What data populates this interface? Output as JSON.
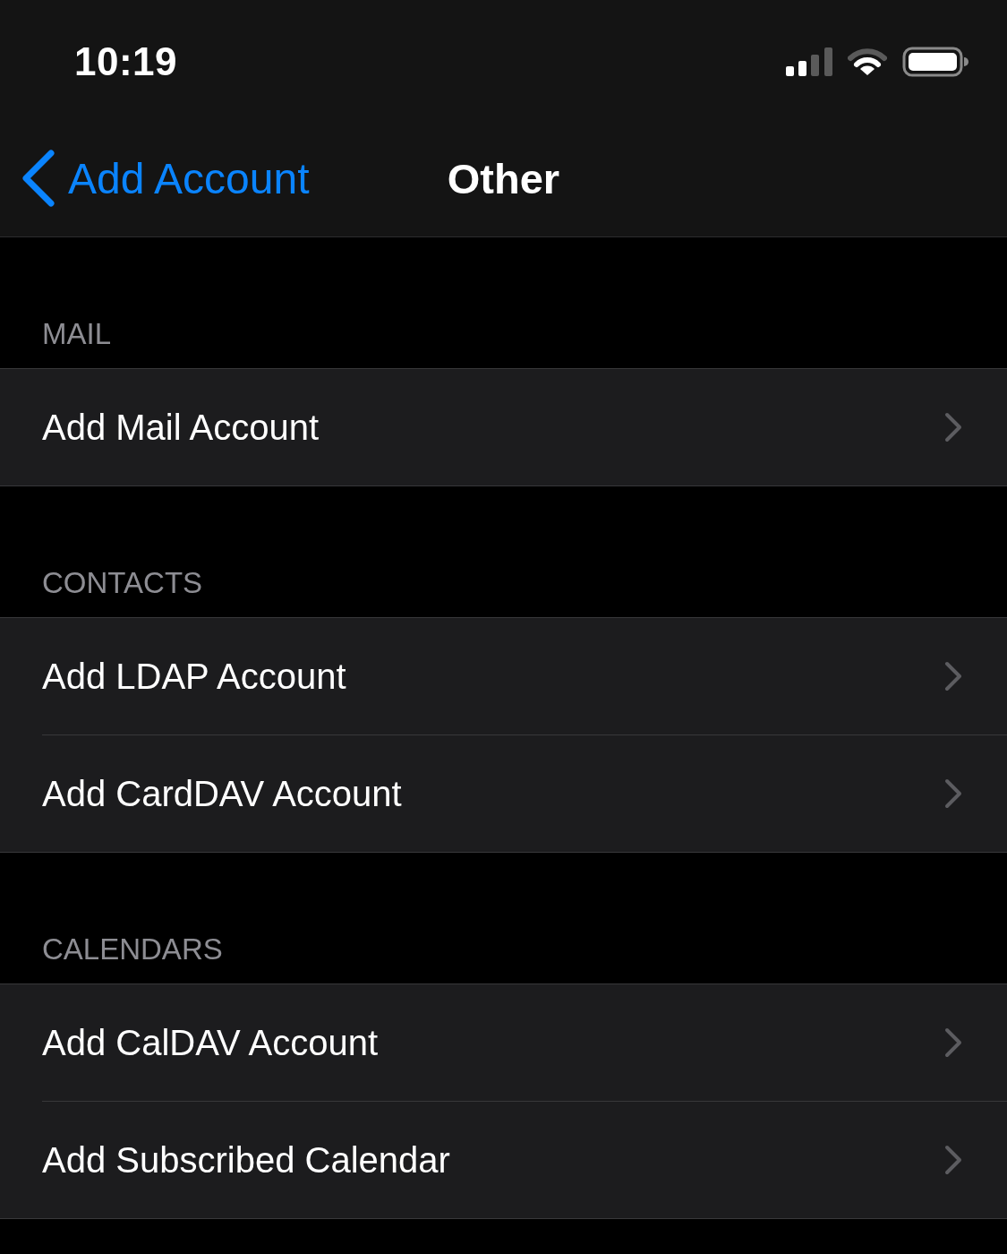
{
  "status_bar": {
    "time": "10:19"
  },
  "nav_bar": {
    "back": "Add Account",
    "title": "Other"
  },
  "sections": [
    {
      "header": "MAIL",
      "rows": [
        {
          "label": "Add Mail Account"
        }
      ]
    },
    {
      "header": "CONTACTS",
      "rows": [
        {
          "label": "Add LDAP Account"
        },
        {
          "label": "Add CardDAV Account"
        }
      ]
    },
    {
      "header": "CALENDARS",
      "rows": [
        {
          "label": "Add CalDAV Account"
        },
        {
          "label": "Add Subscribed Calendar"
        }
      ]
    }
  ]
}
